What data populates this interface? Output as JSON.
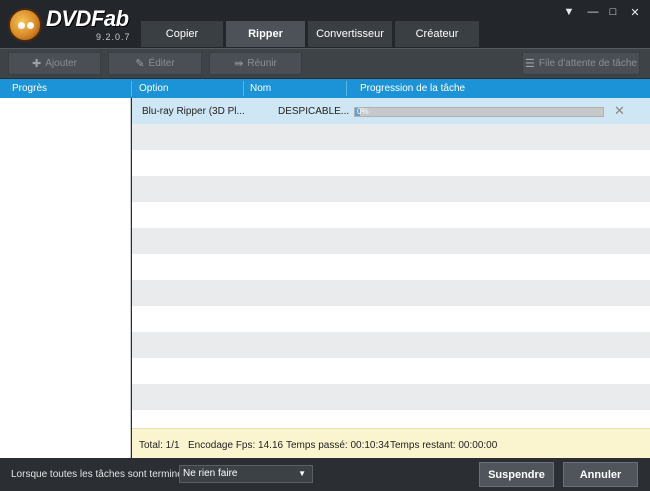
{
  "app": {
    "brand": "DVDFab",
    "version": "9.2.0.7"
  },
  "tabs": [
    {
      "label": "Copier",
      "active": false
    },
    {
      "label": "Ripper",
      "active": true
    },
    {
      "label": "Convertisseur",
      "active": false
    },
    {
      "label": "Créateur",
      "active": false
    }
  ],
  "toolbar": {
    "add_label": "Ajouter",
    "edit_label": "Éditer",
    "retry_label": "Réunir",
    "queue_label": "File d'attente de tâche"
  },
  "header": {
    "left_label": "Progrès",
    "col_option": "Option",
    "col_name": "Nom",
    "col_progress": "Progression de la tâche"
  },
  "tasks": [
    {
      "option": "Blu-ray Ripper (3D Pl...",
      "name": "DESPICABLE...",
      "progress_text": "0%",
      "progress_value": 0.02
    }
  ],
  "status": {
    "total": "Total: 1/1",
    "fps": "Encodage Fps: 14.16",
    "elapsed": "Temps passé: 00:10:34",
    "remaining": "Temps restant: 00:00:00"
  },
  "bottom": {
    "when_done_label": "Lorsque toutes les tâches sont terminées:",
    "when_done_value": "Ne rien faire",
    "suspend_label": "Suspendre",
    "cancel_label": "Annuler"
  },
  "colors": {
    "header_blue": "#1c93d6",
    "status_bg": "#fbf5cf",
    "selected_row": "#cfe6f4"
  }
}
